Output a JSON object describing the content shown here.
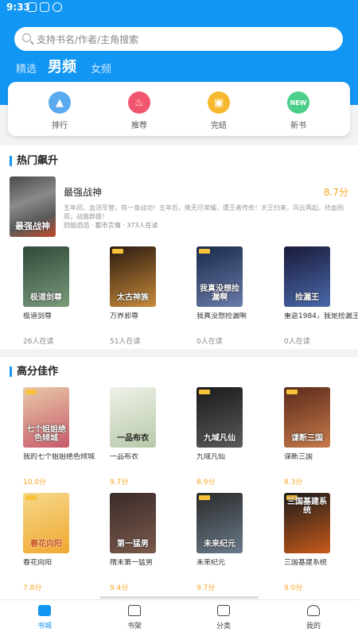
{
  "status": {
    "time": "9:33"
  },
  "search": {
    "placeholder": "支持书名/作者/主角搜索"
  },
  "tabs": [
    {
      "label": "精选"
    },
    {
      "label": "男频"
    },
    {
      "label": "女频"
    }
  ],
  "categories": [
    {
      "label": "排行",
      "icon": "trophy-icon",
      "color": "#5aaaf0"
    },
    {
      "label": "推荐",
      "icon": "flame-icon",
      "color": "#f2566e"
    },
    {
      "label": "完结",
      "icon": "book-icon",
      "color": "#f5b82e"
    },
    {
      "label": "新书",
      "icon": "new-icon",
      "color": "#4ccf8a"
    }
  ],
  "hot": {
    "title": "热门飙升",
    "featured": {
      "title": "最强战神",
      "score": "8.7分",
      "cover_text": "最强战神",
      "desc": "五年间，血浴军营，铁一身战功！五年后，携无尽荣耀，遭王者传奇！天王归来，风云再起，终血刑雨，战傲群雄！",
      "meta": "烈焰滔滔 · 都市言情 · 373人在读"
    },
    "books": [
      {
        "title": "极道剑尊",
        "sub": "26人在读",
        "cover_text": "极道剑尊",
        "color1": "#2f4a3a",
        "color2": "#7a9a7a"
      },
      {
        "title": "万界邪尊",
        "sub": "51人在读",
        "cover_text": "太古神族",
        "color1": "#2a1a10",
        "color2": "#c88a3a"
      },
      {
        "title": "我真没想捡漏啊",
        "sub": "0人在读",
        "cover_text": "我真没想捡漏啊",
        "color1": "#1a2a4a",
        "color2": "#6a7aaa"
      },
      {
        "title": "重返1984，我是捡漏王",
        "sub": "0人在读",
        "cover_text": "捡漏王",
        "color1": "#1a1a3a",
        "color2": "#4a6aaa"
      }
    ]
  },
  "top": {
    "title": "高分佳作",
    "books": [
      {
        "title": "我的七个姐姐绝色倾城",
        "sub": "10.0分",
        "cover_text": "七个姐姐绝色倾城",
        "color1": "#e8c9a8",
        "color2": "#c85a6a"
      },
      {
        "title": "一品布衣",
        "sub": "9.7分",
        "cover_text": "一品布衣",
        "color1": "#eef2e8",
        "color2": "#b8c8a8"
      },
      {
        "title": "九域凡仙",
        "sub": "8.9分",
        "cover_text": "九域凡仙",
        "color1": "#1a1a1a",
        "color2": "#5a5a5a"
      },
      {
        "title": "谍断三国",
        "sub": "8.3分",
        "cover_text": "谍断三国",
        "color1": "#5a2a1a",
        "color2": "#c87a4a"
      },
      {
        "title": "春花向阳",
        "sub": "7.8分",
        "cover_text": "春花向阳",
        "color1": "#f5d88a",
        "color2": "#f0a830"
      },
      {
        "title": "隋末第一猛男",
        "sub": "9.4分",
        "cover_text": "第一猛男",
        "color1": "#3a2a2a",
        "color2": "#7a5a4a"
      },
      {
        "title": "未来纪元",
        "sub": "9.7分",
        "cover_text": "未来纪元",
        "color1": "#2a2a2a",
        "color2": "#6a7a8a"
      },
      {
        "title": "三国基建系统",
        "sub": "9.0分",
        "cover_text": "三国基建系统",
        "color1": "#1a1a1a",
        "color2": "#c85a1a"
      }
    ]
  },
  "nav": [
    {
      "label": "书城",
      "icon": "bookstore-icon"
    },
    {
      "label": "书架",
      "icon": "bookshelf-icon"
    },
    {
      "label": "分类",
      "icon": "category-icon"
    },
    {
      "label": "我的",
      "icon": "profile-icon"
    }
  ],
  "colors": {
    "accent": "#1296f3",
    "score": "#f5a623"
  }
}
